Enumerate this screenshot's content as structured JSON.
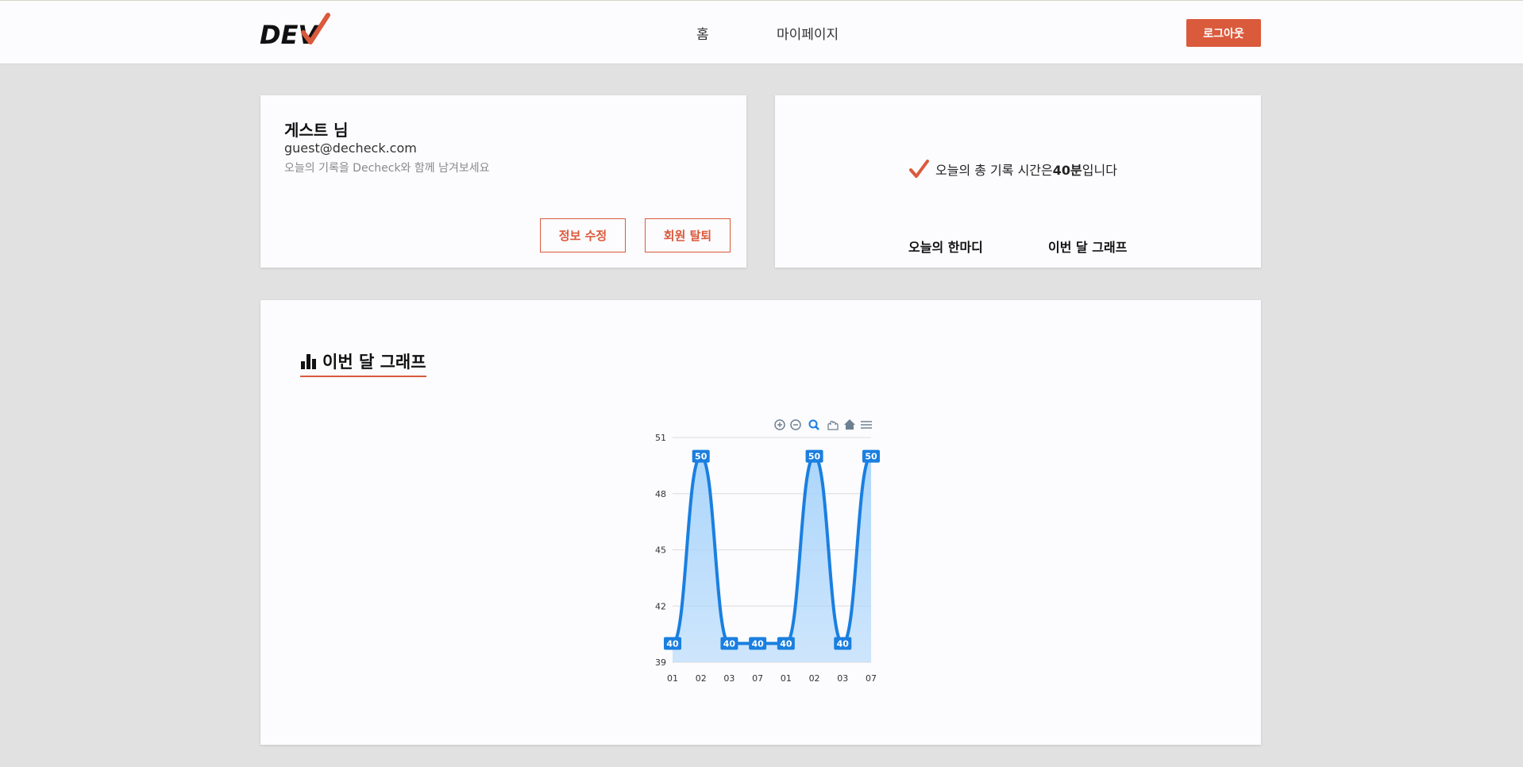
{
  "header": {
    "logo_text": "DEV",
    "nav": [
      {
        "label": "홈"
      },
      {
        "label": "마이페이지"
      }
    ],
    "logout_label": "로그아웃"
  },
  "profile": {
    "name": "게스트 님",
    "email": "guest@decheck.com",
    "message": "오늘의 기록을 Decheck와 함께 남겨보세요",
    "edit_label": "정보 수정",
    "withdraw_label": "회원 탈퇴"
  },
  "today": {
    "prefix": "오늘의 총 기록 시간은 ",
    "value": "40분",
    "suffix": " 입니다",
    "comment_link": "오늘의 한마디",
    "graph_link": "이번 달 그래프"
  },
  "graph_section": {
    "title": "이번 달 그래프"
  },
  "colors": {
    "accent": "#da5a3c",
    "series": "#1a7fe0",
    "area": "#a8d4fb"
  },
  "chart_data": {
    "type": "area",
    "x": [
      "01",
      "02",
      "03",
      "07",
      "01",
      "02",
      "03",
      "07"
    ],
    "series": [
      {
        "values": [
          40,
          50,
          40,
          40,
          40,
          50,
          40,
          50
        ]
      }
    ],
    "ylim": [
      39,
      51
    ],
    "yticks": [
      39,
      42,
      45,
      48,
      51
    ],
    "data_labels": true,
    "grid": true,
    "toolbar": [
      "zoom-in-icon",
      "zoom-out-icon",
      "zoom-selection-icon",
      "pan-hand-icon",
      "reset-home-icon",
      "menu-icon"
    ]
  }
}
